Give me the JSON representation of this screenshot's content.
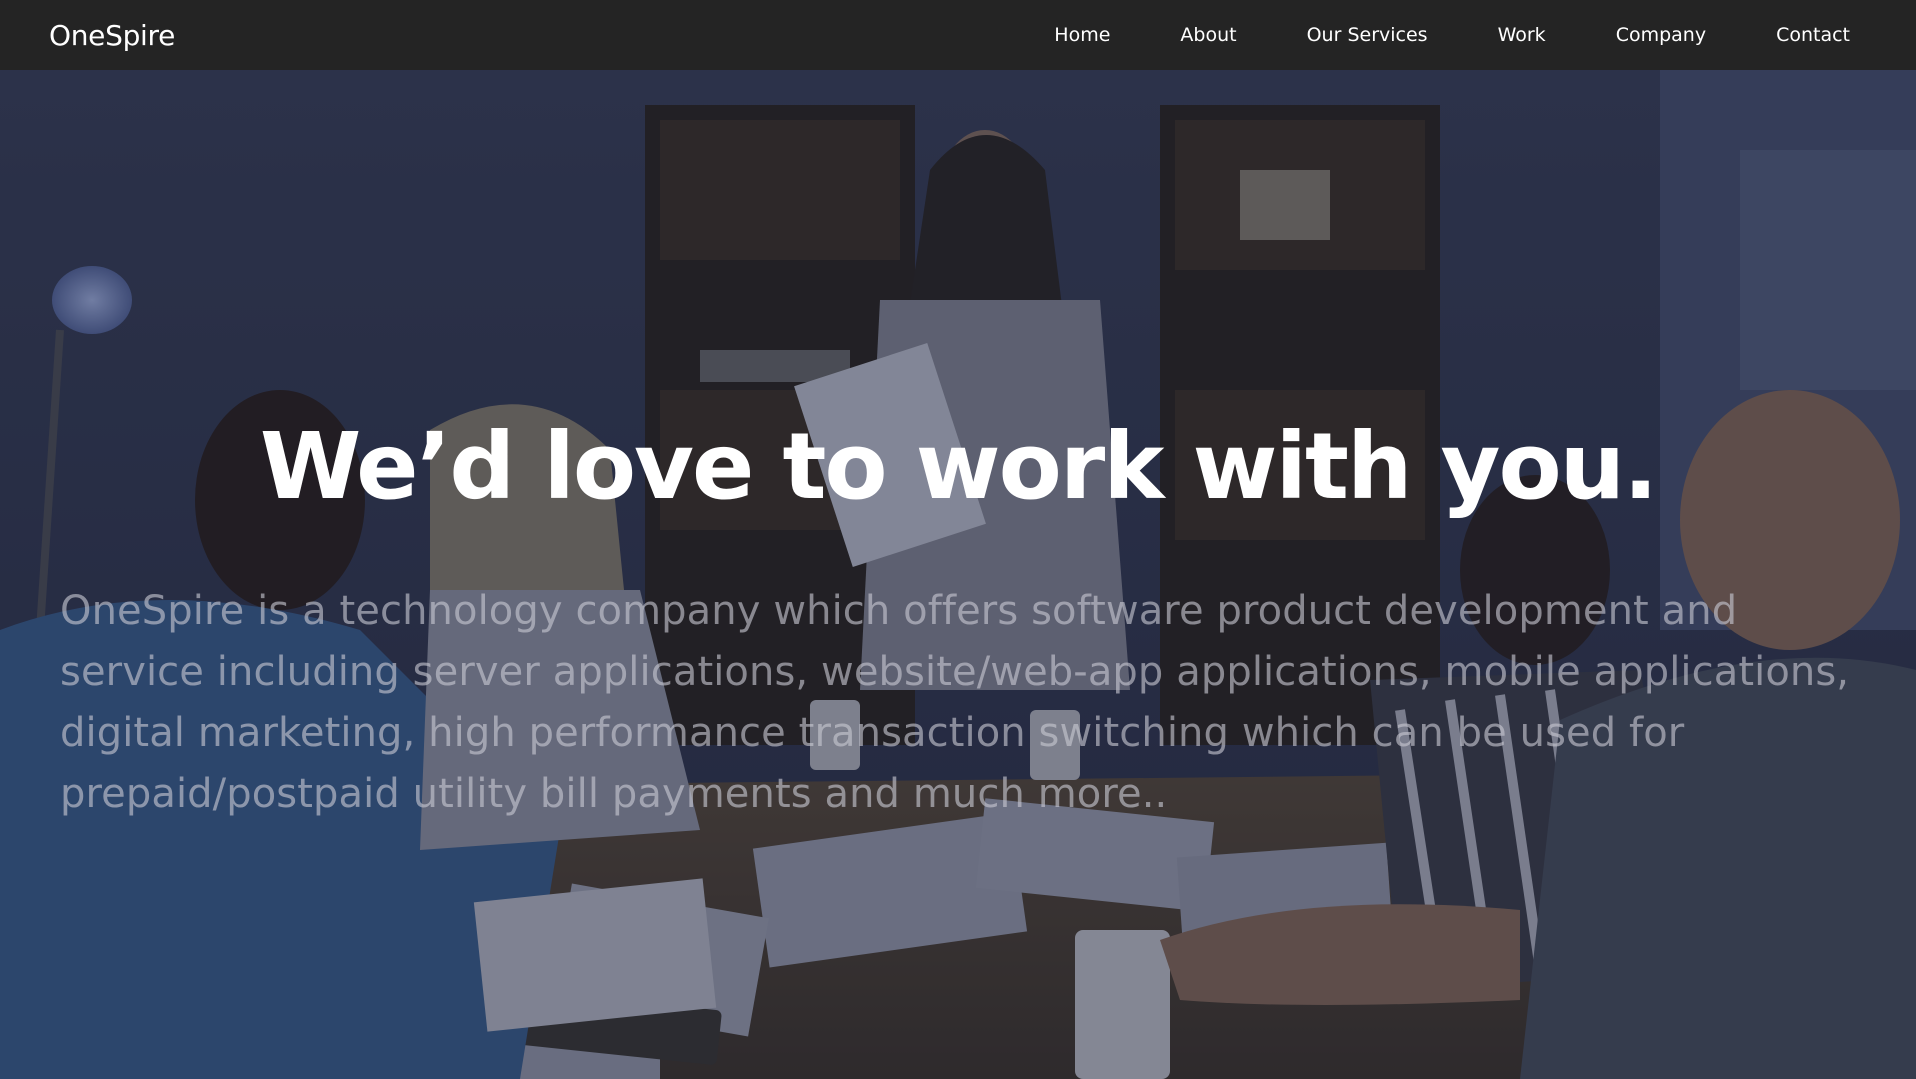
{
  "brand": {
    "name": "OneSpire"
  },
  "nav": {
    "items": [
      {
        "label": "Home"
      },
      {
        "label": "About"
      },
      {
        "label": "Our Services"
      },
      {
        "label": "Work"
      },
      {
        "label": "Company"
      },
      {
        "label": "Contact"
      }
    ]
  },
  "hero": {
    "title": "We’d love to work with you.",
    "description": "OneSpire is a technology company which offers software product development and service including server applications, website/web-app applications, mobile applications, digital marketing, high performance transaction switching which can be used for prepaid/postpaid utility bill payments and much more.."
  },
  "colors": {
    "navbar": "#242424",
    "text_primary": "#ffffff",
    "text_muted": "#c8c8d2"
  }
}
